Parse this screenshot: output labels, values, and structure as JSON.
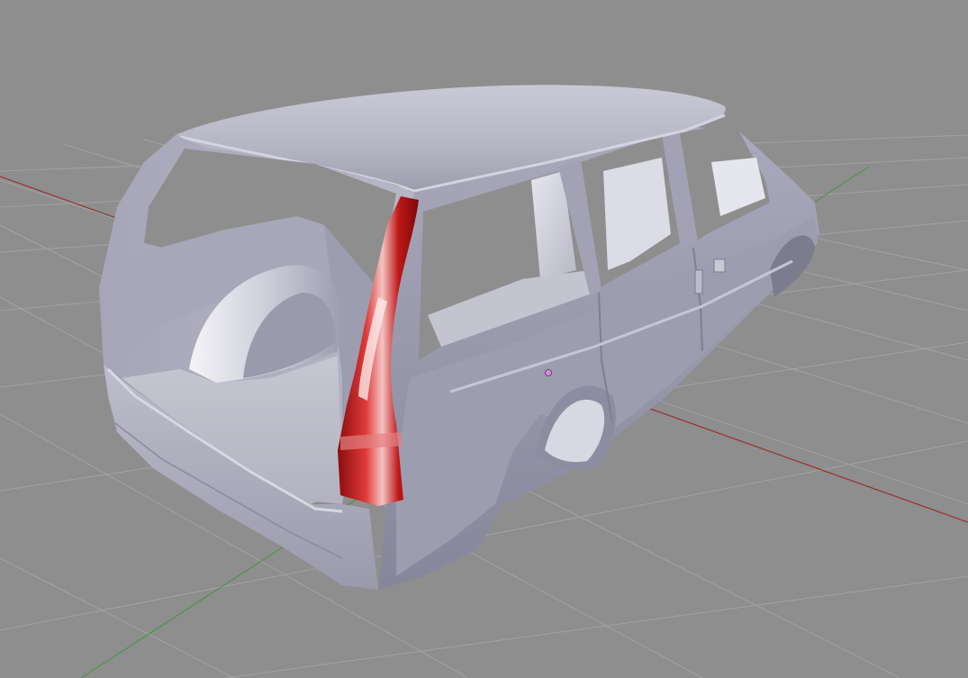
{
  "viewport": {
    "background_color": "#8e8e8e",
    "grid_color": "#a3a3a3",
    "axis_x_color": "#9a2222",
    "axis_y_color": "#3a9a3a",
    "object_color": "#b8b8c8",
    "taillight_color": "#c01818",
    "object_origin_color": "#e088e0",
    "grid_visible": true
  },
  "object": {
    "type": "station-wagon-body-mesh"
  }
}
